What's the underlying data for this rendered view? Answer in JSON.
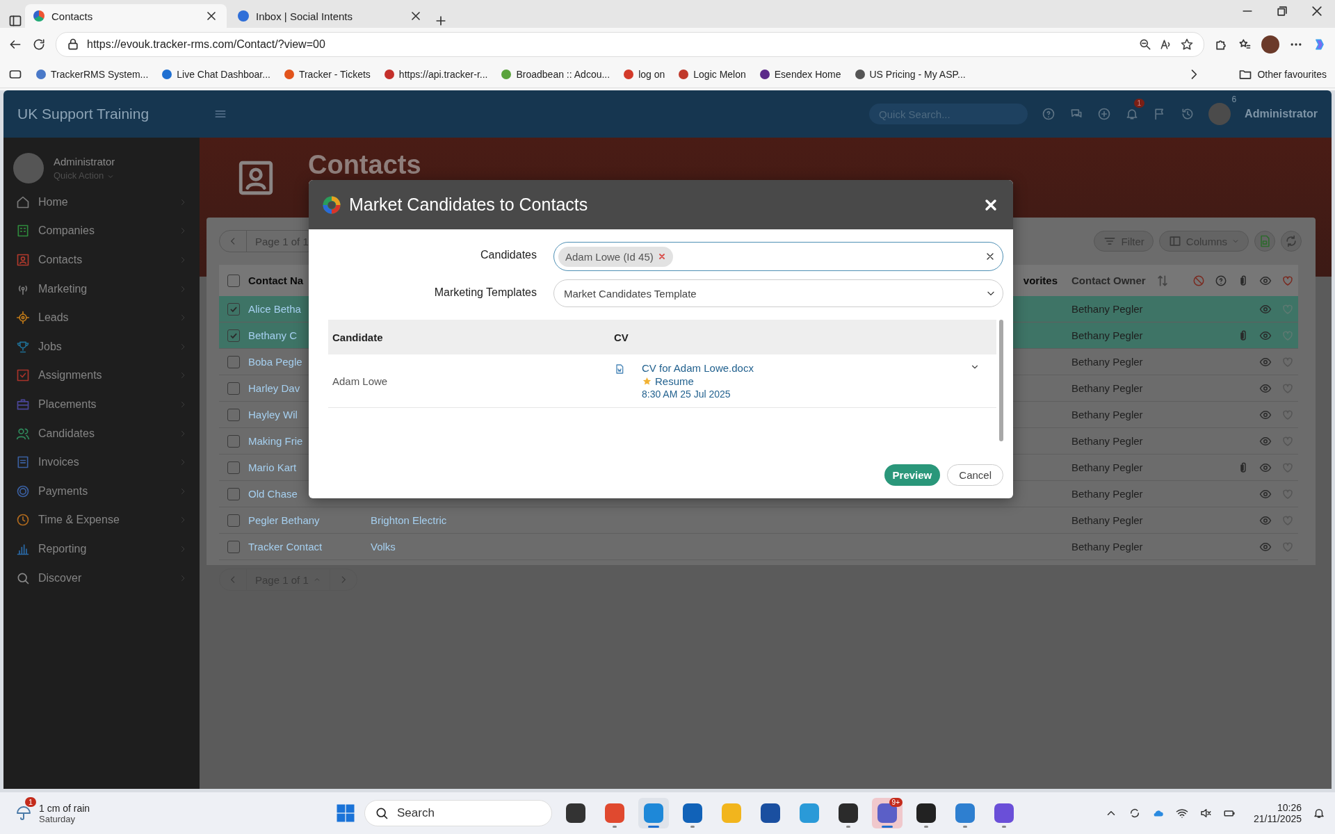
{
  "browser": {
    "tabs": [
      {
        "title": "Contacts",
        "selected": true
      },
      {
        "title": "Inbox | Social Intents",
        "selected": false
      }
    ],
    "url": "https://evouk.tracker-rms.com/Contact/?view=00",
    "bookmarks": [
      "TrackerRMS System...",
      "Live Chat Dashboar...",
      "Tracker - Tickets",
      "https://api.tracker-r...",
      "Broadbean :: Adcou...",
      "log on",
      "Logic Melon",
      "Esendex Home",
      "US Pricing - My ASP..."
    ],
    "other_favourites": "Other favourites"
  },
  "header": {
    "brand": "UK Support Training",
    "search": {
      "placeholder": "Quick Search..."
    },
    "notification_badge": "1",
    "user_badge": "6",
    "user": "Administrator"
  },
  "sidebar": {
    "user": "Administrator",
    "quick_action": "Quick Action",
    "items": [
      {
        "label": "Home",
        "color": "#7a7a7a"
      },
      {
        "label": "Companies",
        "color": "#2f8a3c"
      },
      {
        "label": "Contacts",
        "color": "#b0392c"
      },
      {
        "label": "Marketing",
        "color": "#7a7a7a"
      },
      {
        "label": "Leads",
        "color": "#c07a18"
      },
      {
        "label": "Jobs",
        "color": "#1f6f95"
      },
      {
        "label": "Assignments",
        "color": "#a8332a"
      },
      {
        "label": "Placements",
        "color": "#4a4596"
      },
      {
        "label": "Candidates",
        "color": "#2f8a5c"
      },
      {
        "label": "Invoices",
        "color": "#3a5fa0"
      },
      {
        "label": "Payments",
        "color": "#3a5fa0"
      },
      {
        "label": "Time & Expense",
        "color": "#b06a1e"
      },
      {
        "label": "Reporting",
        "color": "#2a6aa8"
      },
      {
        "label": "Discover",
        "color": "#8a8a8a"
      }
    ]
  },
  "page": {
    "title": "Contacts"
  },
  "table": {
    "pager_top": "Page 1 of 1",
    "toolbar": [
      "Filter",
      "Columns"
    ],
    "columns": [
      "Contact Na",
      "vorites",
      "Contact Owner"
    ],
    "all_selected": false,
    "rows": [
      {
        "name": "Alice Betha",
        "owner": "Bethany Pegler",
        "selected": true,
        "attachment": false
      },
      {
        "name": "Bethany C",
        "owner": "Bethany Pegler",
        "selected": true,
        "attachment": true
      },
      {
        "name": "Boba Pegle",
        "owner": "Bethany Pegler",
        "selected": false,
        "attachment": false
      },
      {
        "name": "Harley Dav",
        "owner": "Bethany Pegler",
        "selected": false,
        "attachment": false
      },
      {
        "name": "Hayley Wil",
        "owner": "Bethany Pegler",
        "selected": false,
        "attachment": false
      },
      {
        "name": "Making Frie",
        "owner": "Bethany Pegler",
        "selected": false,
        "attachment": false
      },
      {
        "name": "Mario Kart",
        "owner": "Bethany Pegler",
        "selected": false,
        "attachment": true
      },
      {
        "name": "Old Chase",
        "owner": "Bethany Pegler",
        "selected": false,
        "attachment": false
      },
      {
        "name": "Pegler Bethany",
        "company": "Brighton Electric",
        "owner": "Bethany Pegler",
        "selected": false,
        "attachment": false
      },
      {
        "name": "Tracker Contact",
        "company": "Volks",
        "owner": "Bethany Pegler",
        "selected": false,
        "attachment": false
      }
    ],
    "pager_bottom": "Page 1 of 1"
  },
  "modal": {
    "title": "Market Candidates to Contacts",
    "candidates_label": "Candidates",
    "candidate_chip": "Adam Lowe (Id 45)",
    "templates_label": "Marketing Templates",
    "template": "Market Candidates Template",
    "columns": [
      "Candidate",
      "CV"
    ],
    "rows": [
      {
        "candidate": "Adam Lowe",
        "cv_file": "CV for Adam Lowe.docx",
        "cv_type": "Resume",
        "cv_date": "8:30 AM 25 Jul 2025"
      }
    ],
    "buttons": [
      "Preview",
      "Cancel"
    ]
  },
  "taskbar": {
    "weather_badge": "1",
    "weather": "1 cm of rain",
    "day": "Saturday",
    "search": {
      "placeholder": "Search"
    },
    "apps": [
      {
        "running": false,
        "selected": false
      },
      {
        "running": true,
        "selected": false
      },
      {
        "running": true,
        "selected": true
      },
      {
        "running": true,
        "selected": false
      },
      {
        "running": false,
        "selected": false
      },
      {
        "running": false,
        "selected": false
      },
      {
        "running": false,
        "selected": false
      },
      {
        "running": true,
        "selected": false
      },
      {
        "running": true,
        "selected": true,
        "badge": "9+"
      },
      {
        "running": true,
        "selected": false
      },
      {
        "running": true,
        "selected": false
      },
      {
        "running": true,
        "selected": false
      }
    ],
    "time": "10:26",
    "date": "21/11/2025"
  }
}
